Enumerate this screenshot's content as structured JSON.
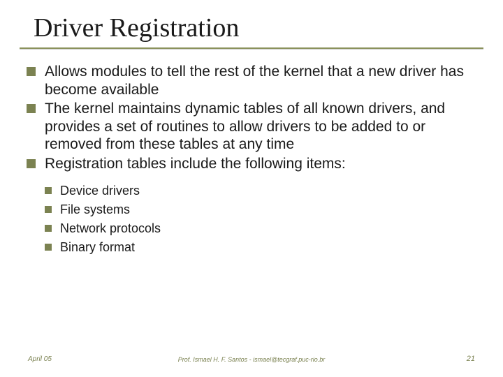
{
  "title": "Driver Registration",
  "bullets": [
    "Allows modules to tell the rest of the kernel that a new driver has become available",
    "The kernel maintains dynamic tables of all known drivers, and provides a set of routines to allow drivers to be added to or removed from these tables at any time",
    "Registration tables include the following items:"
  ],
  "sub_bullets": [
    "Device drivers",
    "File systems",
    "Network protocols",
    "Binary format"
  ],
  "footer": {
    "left": "April 05",
    "center": "Prof. Ismael H. F. Santos - ismael@tecgraf.puc-rio.br",
    "right": "21"
  }
}
